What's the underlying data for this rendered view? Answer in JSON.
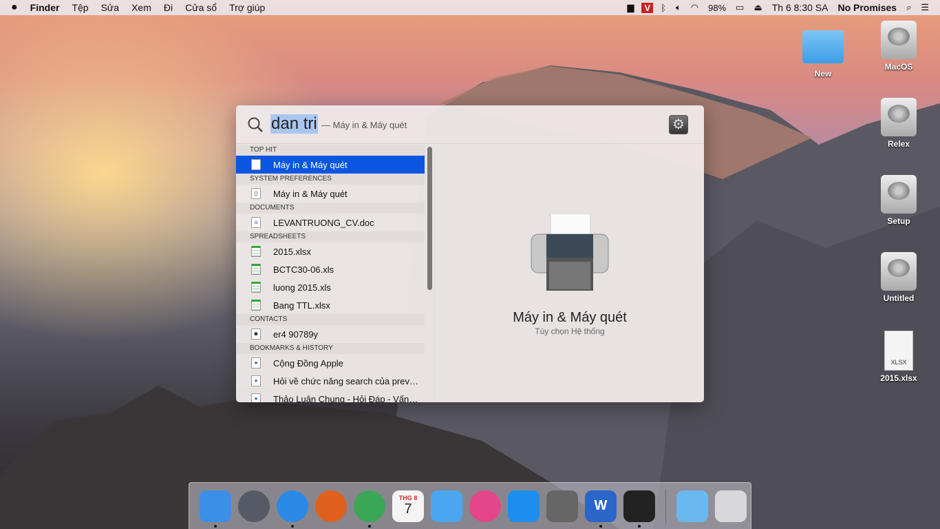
{
  "menubar": {
    "apple": "",
    "items": [
      "Finder",
      "Tệp",
      "Sửa",
      "Xem",
      "Đi",
      "Cửa sổ",
      "Trợ giúp"
    ],
    "status": {
      "battery": "98%",
      "clock": "Th 6 8:30 SA",
      "user": "No Promises"
    }
  },
  "spotlight": {
    "query": "dan tri",
    "hint": "— Máy in & Máy quét",
    "sections": [
      {
        "title": "TOP HIT",
        "items": [
          {
            "label": "Máy in & Máy quét",
            "icon": "preference-icon",
            "selected": true
          }
        ]
      },
      {
        "title": "SYSTEM PREFERENCES",
        "items": [
          {
            "label": "Máy in & Máy quét",
            "icon": "preference-icon"
          }
        ]
      },
      {
        "title": "DOCUMENTS",
        "items": [
          {
            "label": "LEVANTRUONG_CV.doc",
            "icon": "doc-icon"
          }
        ]
      },
      {
        "title": "SPREADSHEETS",
        "items": [
          {
            "label": "2015.xlsx",
            "icon": "spreadsheet-icon"
          },
          {
            "label": "BCTC30-06.xls",
            "icon": "spreadsheet-icon"
          },
          {
            "label": "luong 2015.xls",
            "icon": "spreadsheet-icon"
          },
          {
            "label": "Bang TTL.xlsx",
            "icon": "spreadsheet-icon"
          }
        ]
      },
      {
        "title": "CONTACTS",
        "items": [
          {
            "label": "er4 90789y",
            "icon": "contact-icon"
          }
        ]
      },
      {
        "title": "BOOKMARKS & HISTORY",
        "items": [
          {
            "label": "Cộng Đồng Apple",
            "icon": "webpage-icon"
          },
          {
            "label": "Hỏi về chức năng search của prev…",
            "icon": "webpage-icon"
          },
          {
            "label": "Thảo Luận Chung - Hỏi Đáp - Vấn…",
            "icon": "webpage-icon"
          }
        ]
      }
    ],
    "preview": {
      "title": "Máy in & Máy quét",
      "subtitle": "Tùy chọn Hệ thống"
    }
  },
  "desktop": [
    {
      "label": "New",
      "type": "folder"
    },
    {
      "label": "MacOS",
      "type": "disk"
    },
    {
      "label": "Relex",
      "type": "disk"
    },
    {
      "label": "Setup",
      "type": "disk"
    },
    {
      "label": "Untitled",
      "type": "disk"
    },
    {
      "label": "2015.xlsx",
      "type": "xlsx",
      "badge": "XLSX"
    }
  ],
  "dock": {
    "apps": [
      {
        "name": "finder",
        "color": "#3b8fe8",
        "run": true
      },
      {
        "name": "launchpad",
        "color": "#555a66"
      },
      {
        "name": "safari",
        "color": "#2a8ae6",
        "run": true
      },
      {
        "name": "firefox",
        "color": "#e0601e"
      },
      {
        "name": "chrome",
        "color": "#3aa757",
        "run": true
      },
      {
        "name": "calendar",
        "color": "#f4f4f4",
        "month": "THG 8",
        "day": "7"
      },
      {
        "name": "messages",
        "color": "#4aa6f0"
      },
      {
        "name": "itunes",
        "color": "#e5458a"
      },
      {
        "name": "app-store",
        "color": "#1d8ef0"
      },
      {
        "name": "system-preferences",
        "color": "#666"
      },
      {
        "name": "word",
        "color": "#2a65c8",
        "letter": "W",
        "run": true
      },
      {
        "name": "activity-monitor",
        "color": "#222",
        "run": true
      }
    ],
    "stack": [
      {
        "name": "downloads",
        "color": "#6ab8f0"
      },
      {
        "name": "trash",
        "color": "#d8d8dc"
      }
    ]
  }
}
